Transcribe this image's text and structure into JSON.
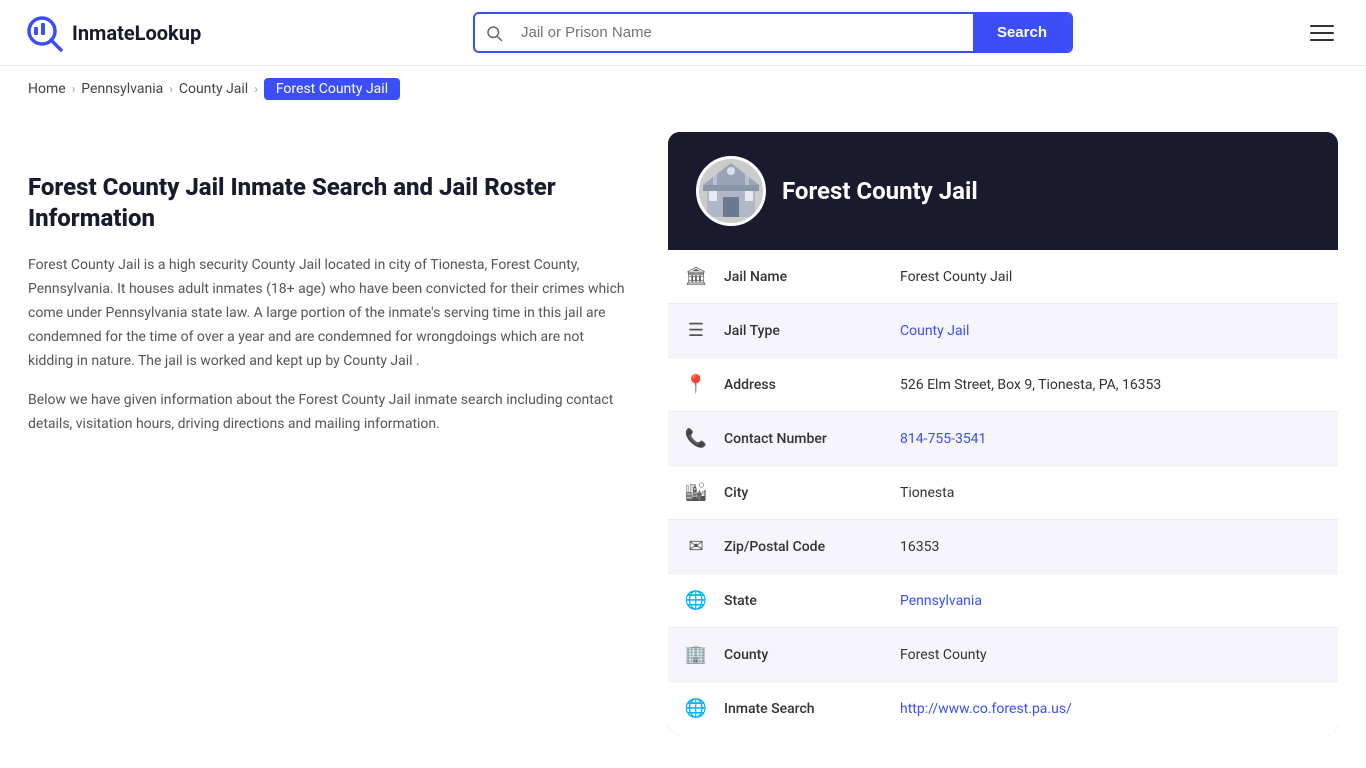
{
  "header": {
    "logo_text": "InmateLookup",
    "search_placeholder": "Jail or Prison Name",
    "search_button_label": "Search"
  },
  "breadcrumb": {
    "items": [
      {
        "label": "Home",
        "href": "#"
      },
      {
        "label": "Pennsylvania",
        "href": "#"
      },
      {
        "label": "County Jail",
        "href": "#"
      }
    ],
    "current": "Forest County Jail"
  },
  "left": {
    "heading": "Forest County Jail Inmate Search and Jail Roster Information",
    "paragraph1": "Forest County Jail is a high security County Jail located in city of Tionesta, Forest County, Pennsylvania. It houses adult inmates (18+ age) who have been convicted for their crimes which come under Pennsylvania state law. A large portion of the inmate's serving time in this jail are condemned for the time of over a year and are condemned for wrongdoings which are not kidding in nature. The jail is worked and kept up by County Jail .",
    "paragraph2": "Below we have given information about the Forest County Jail inmate search including contact details, visitation hours, driving directions and mailing information."
  },
  "card": {
    "title": "Forest County Jail",
    "rows": [
      {
        "icon": "🏛",
        "label": "Jail Name",
        "value": "Forest County Jail",
        "link": null
      },
      {
        "icon": "☰",
        "label": "Jail Type",
        "value": "County Jail",
        "link": "#"
      },
      {
        "icon": "📍",
        "label": "Address",
        "value": "526 Elm Street, Box 9, Tionesta, PA, 16353",
        "link": null
      },
      {
        "icon": "📞",
        "label": "Contact Number",
        "value": "814-755-3541",
        "link": "tel:814-755-3541"
      },
      {
        "icon": "🏙",
        "label": "City",
        "value": "Tionesta",
        "link": null
      },
      {
        "icon": "✉",
        "label": "Zip/Postal Code",
        "value": "16353",
        "link": null
      },
      {
        "icon": "🌐",
        "label": "State",
        "value": "Pennsylvania",
        "link": "#"
      },
      {
        "icon": "🏢",
        "label": "County",
        "value": "Forest County",
        "link": null
      },
      {
        "icon": "🌐",
        "label": "Inmate Search",
        "value": "http://www.co.forest.pa.us/",
        "link": "http://www.co.forest.pa.us/"
      }
    ]
  }
}
